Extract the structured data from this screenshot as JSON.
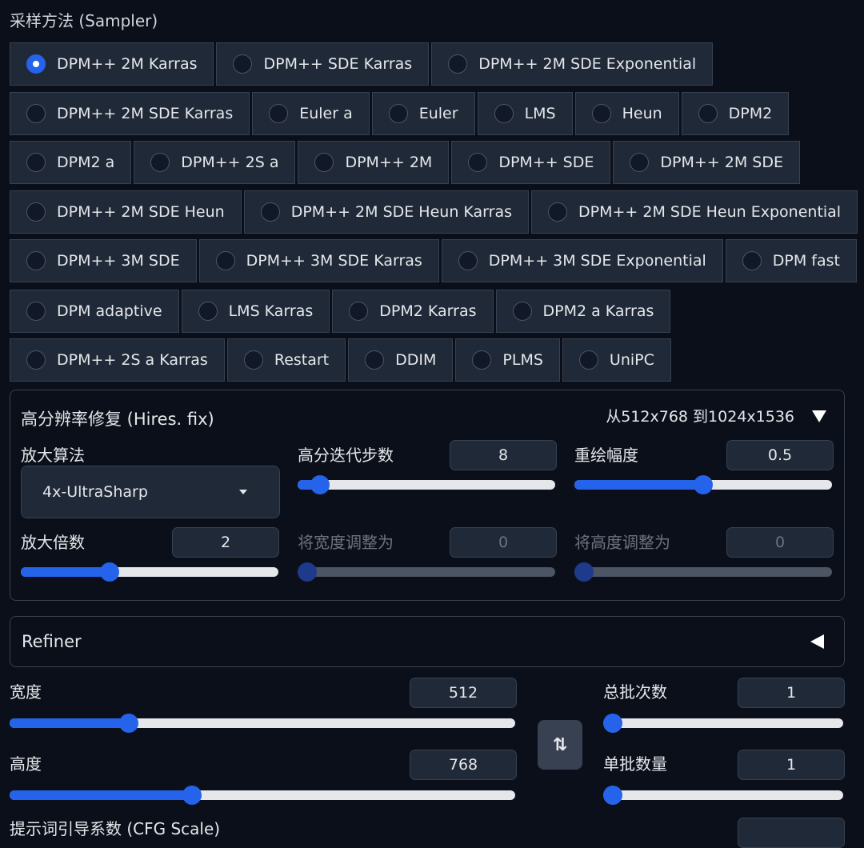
{
  "sampler": {
    "label": "采样方法 (Sampler)",
    "rows": [
      [
        {
          "label": "DPM++ 2M Karras",
          "selected": true
        },
        {
          "label": "DPM++ SDE Karras"
        },
        {
          "label": "DPM++ 2M SDE Exponential"
        }
      ],
      [
        {
          "label": "DPM++ 2M SDE Karras"
        },
        {
          "label": "Euler a"
        },
        {
          "label": "Euler"
        },
        {
          "label": "LMS"
        },
        {
          "label": "Heun"
        },
        {
          "label": "DPM2"
        }
      ],
      [
        {
          "label": "DPM2 a"
        },
        {
          "label": "DPM++ 2S a"
        },
        {
          "label": "DPM++ 2M"
        },
        {
          "label": "DPM++ SDE"
        },
        {
          "label": "DPM++ 2M SDE"
        }
      ],
      [
        {
          "label": "DPM++ 2M SDE Heun"
        },
        {
          "label": "DPM++ 2M SDE Heun Karras"
        },
        {
          "label": "DPM++ 2M SDE Heun Exponential"
        }
      ],
      [
        {
          "label": "DPM++ 3M SDE"
        },
        {
          "label": "DPM++ 3M SDE Karras"
        },
        {
          "label": "DPM++ 3M SDE Exponential"
        },
        {
          "label": "DPM fast"
        }
      ],
      [
        {
          "label": "DPM adaptive"
        },
        {
          "label": "LMS Karras"
        },
        {
          "label": "DPM2 Karras"
        },
        {
          "label": "DPM2 a Karras"
        }
      ],
      [
        {
          "label": "DPM++ 2S a Karras"
        },
        {
          "label": "Restart"
        },
        {
          "label": "DDIM"
        },
        {
          "label": "PLMS"
        },
        {
          "label": "UniPC"
        }
      ]
    ]
  },
  "hires": {
    "title": "高分辨率修复 (Hires. fix)",
    "summary": "从512x768 到1024x1536",
    "upscaler": {
      "label": "放大算法",
      "value": "4x-UltraSharp"
    },
    "steps": {
      "label": "高分迭代步数",
      "value": "8",
      "min": 0,
      "max": 150
    },
    "denoise": {
      "label": "重绘幅度",
      "value": "0.5",
      "min": 0,
      "max": 1
    },
    "scale": {
      "label": "放大倍数",
      "value": "2",
      "min": 1,
      "max": 4
    },
    "resize_width": {
      "label": "将宽度调整为",
      "value": "0",
      "min": 0,
      "max": 2048
    },
    "resize_height": {
      "label": "将高度调整为",
      "value": "0",
      "min": 0,
      "max": 2048
    }
  },
  "refiner": {
    "title": "Refiner"
  },
  "width": {
    "label": "宽度",
    "value": "512",
    "min": 64,
    "max": 2048
  },
  "height": {
    "label": "高度",
    "value": "768",
    "min": 64,
    "max": 2048
  },
  "batch_count": {
    "label": "总批次数",
    "value": "1",
    "min": 1,
    "max": 100
  },
  "batch_size": {
    "label": "单批数量",
    "value": "1",
    "min": 1,
    "max": 8
  },
  "swap_button": {
    "label": "⇅"
  },
  "cfg": {
    "label": "提示词引导系数 (CFG Scale)"
  }
}
